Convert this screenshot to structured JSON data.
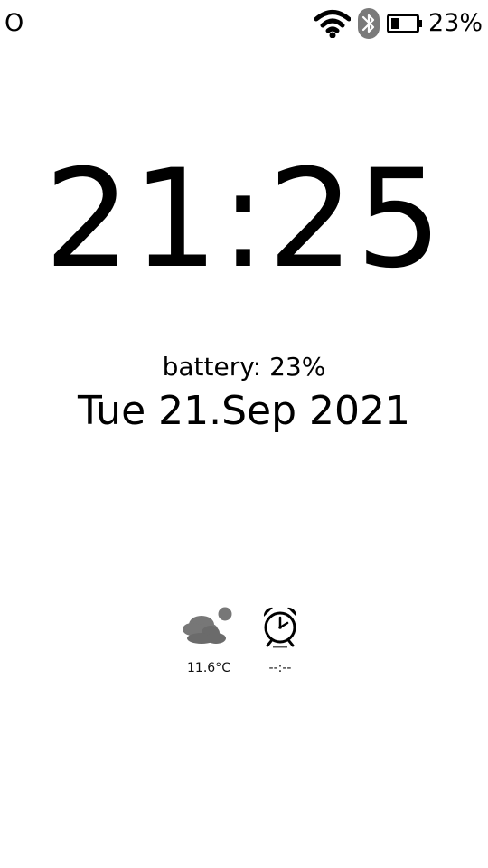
{
  "status_bar": {
    "left_text": "O",
    "battery_percent": "23%",
    "battery_level": 0.23,
    "icons": [
      "wifi-icon",
      "bluetooth-icon",
      "battery-icon"
    ]
  },
  "clock": {
    "time": "21:25",
    "battery_text": "battery: 23%",
    "date": "Tue 21.Sep 2021"
  },
  "widgets": {
    "weather": {
      "icon": "cloudy-weather-icon",
      "value": "11.6°C"
    },
    "alarm": {
      "icon": "alarm-clock-icon",
      "value": "--:--"
    }
  }
}
